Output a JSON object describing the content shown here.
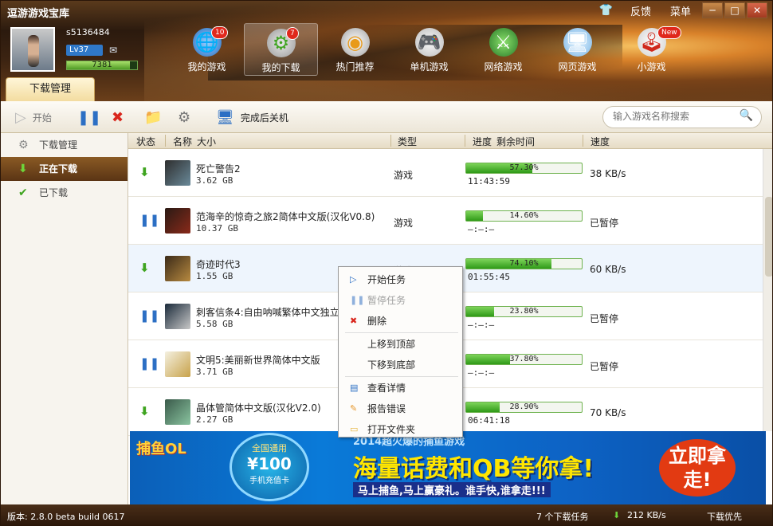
{
  "app": {
    "title": "逗游游戏宝库",
    "feedback": "反馈",
    "menu": "菜单"
  },
  "user": {
    "name": "s5136484",
    "level": "Lv37",
    "exp": "7381",
    "exp_fraction": 0.9
  },
  "nav": [
    {
      "label": "我的游戏",
      "badge": "10",
      "icon": "globe-icon"
    },
    {
      "label": "我的下载",
      "badge": "7",
      "icon": "gear-download-icon"
    },
    {
      "label": "热门推荐",
      "badge": "",
      "icon": "disc-icon"
    },
    {
      "label": "单机游戏",
      "badge": "",
      "icon": "gamepad-icon"
    },
    {
      "label": "网络游戏",
      "badge": "",
      "icon": "sword-globe-icon"
    },
    {
      "label": "网页游戏",
      "badge": "",
      "icon": "web-icon"
    },
    {
      "label": "小游戏",
      "badge": "New",
      "icon": "joystick-icon"
    }
  ],
  "tab": "下载管理",
  "toolbar": {
    "start": "开始",
    "shutdown": "完成后关机",
    "search_placeholder": "输入游戏名称搜索"
  },
  "sidebar": [
    {
      "label": "下载管理"
    },
    {
      "label": "正在下载"
    },
    {
      "label": "已下载"
    }
  ],
  "columns": {
    "status": "状态",
    "name": "名称",
    "size": "大小",
    "type": "类型",
    "progress": "进度",
    "remain": "剩余时间",
    "speed": "速度"
  },
  "downloads": [
    {
      "name": "死亡警告2",
      "size": "3.62 GB",
      "type": "游戏",
      "progress": "57.30%",
      "pct": 57.3,
      "remain": "11:43:59",
      "speed": "38 KB/s",
      "state": "downloading"
    },
    {
      "name": "范海辛的惊奇之旅2简体中文版(汉化V0.8)",
      "size": "10.37 GB",
      "type": "游戏",
      "progress": "14.60%",
      "pct": 14.6,
      "remain": "—:—:—",
      "speed": "已暂停",
      "state": "paused"
    },
    {
      "name": "奇迹时代3",
      "size": "1.55 GB",
      "type": "游戏",
      "progress": "74.10%",
      "pct": 74.1,
      "remain": "01:55:45",
      "speed": "60 KB/s",
      "state": "downloading"
    },
    {
      "name": "刺客信条4:自由呐喊繁体中文独立",
      "size": "5.58 GB",
      "type": "游戏",
      "progress": "23.80%",
      "pct": 23.8,
      "remain": "—:—:—",
      "speed": "已暂停",
      "state": "paused"
    },
    {
      "name": "文明5:美丽新世界简体中文版",
      "size": "3.71 GB",
      "type": "游戏",
      "progress": "37.80%",
      "pct": 37.8,
      "remain": "—:—:—",
      "speed": "已暂停",
      "state": "paused"
    },
    {
      "name": "晶体管简体中文版(汉化V2.0)",
      "size": "2.27 GB",
      "type": "游戏",
      "progress": "28.90%",
      "pct": 28.9,
      "remain": "06:41:18",
      "speed": "70 KB/s",
      "state": "downloading"
    }
  ],
  "context_menu": [
    {
      "label": "开始任务",
      "icon": "play-icon",
      "disabled": false
    },
    {
      "label": "暂停任务",
      "icon": "pause-icon",
      "disabled": true
    },
    {
      "label": "删除",
      "icon": "delete-icon",
      "disabled": false
    },
    {
      "label": "上移到顶部",
      "icon": "",
      "disabled": false
    },
    {
      "label": "下移到底部",
      "icon": "",
      "disabled": false
    },
    {
      "label": "查看详情",
      "icon": "details-icon",
      "disabled": false
    },
    {
      "label": "报告错误",
      "icon": "report-icon",
      "disabled": false
    },
    {
      "label": "打开文件夹",
      "icon": "folder-icon",
      "disabled": false
    }
  ],
  "banner": {
    "logo": "捕鱼OL",
    "card_top": "全国通用",
    "card_amount": "¥100",
    "card_text": "手机充值卡",
    "headline": "2014超火爆的捕鱼游戏",
    "big": "海量话费和QB等你拿!",
    "sub": "马上捕鱼,马上赢豪礼。谁手快,谁拿走!!!",
    "cta": "立即拿走!"
  },
  "status": {
    "version": "版本: 2.8.0 beta build 0617",
    "tasks": "7 个下载任务",
    "speed": "212 KB/s",
    "priority": "下载优先"
  }
}
